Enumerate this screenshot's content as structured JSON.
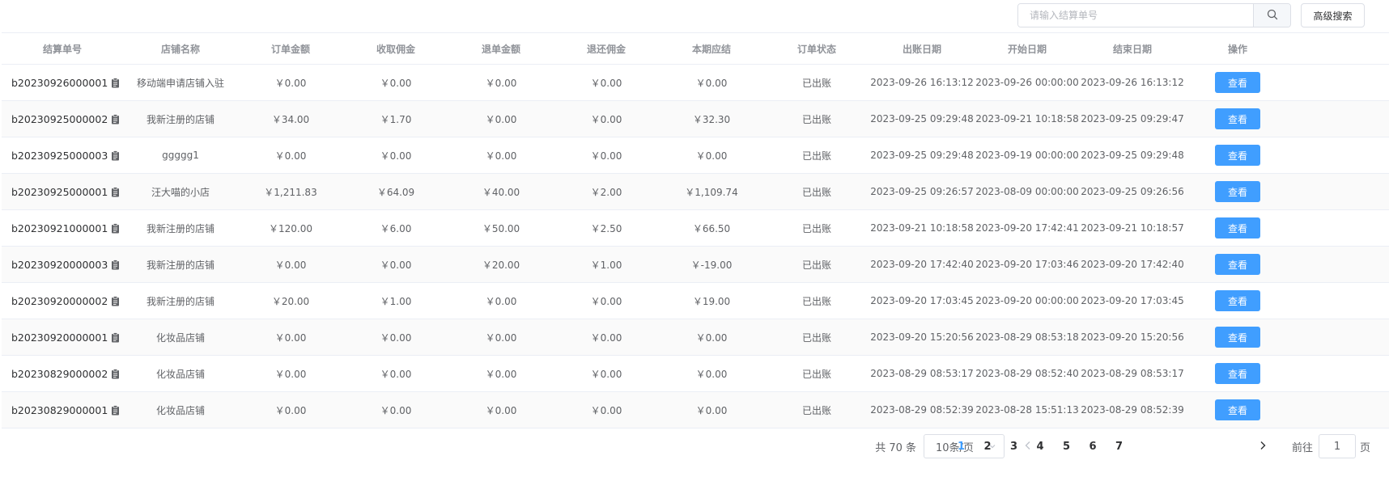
{
  "search": {
    "placeholder": "请输入结算单号",
    "icon": "search-icon"
  },
  "advanced_search_label": "高级搜索",
  "table": {
    "headers": [
      "结算单号",
      "店铺名称",
      "订单金额",
      "收取佣金",
      "退单金额",
      "退还佣金",
      "本期应结",
      "订单状态",
      "出账日期",
      "开始日期",
      "结束日期",
      "操作"
    ],
    "view_label": "查看",
    "rows": [
      {
        "sn": "b20230926000001",
        "store": "移动端申请店铺入驻",
        "order_amount": "￥0.00",
        "commission": "￥0.00",
        "refund_amount": "￥0.00",
        "refund_commission": "￥0.00",
        "payable": "￥0.00",
        "status": "已出账",
        "bill_date": "2023-09-26 16:13:12",
        "start_date": "2023-09-26 00:00:00",
        "end_date": "2023-09-26 16:13:12"
      },
      {
        "sn": "b20230925000002",
        "store": "我新注册的店铺",
        "order_amount": "￥34.00",
        "commission": "￥1.70",
        "refund_amount": "￥0.00",
        "refund_commission": "￥0.00",
        "payable": "￥32.30",
        "status": "已出账",
        "bill_date": "2023-09-25 09:29:48",
        "start_date": "2023-09-21 10:18:58",
        "end_date": "2023-09-25 09:29:47"
      },
      {
        "sn": "b20230925000003",
        "store": "ggggg1",
        "order_amount": "￥0.00",
        "commission": "￥0.00",
        "refund_amount": "￥0.00",
        "refund_commission": "￥0.00",
        "payable": "￥0.00",
        "status": "已出账",
        "bill_date": "2023-09-25 09:29:48",
        "start_date": "2023-09-19 00:00:00",
        "end_date": "2023-09-25 09:29:48"
      },
      {
        "sn": "b20230925000001",
        "store": "汪大喵的小店",
        "order_amount": "￥1,211.83",
        "commission": "￥64.09",
        "refund_amount": "￥40.00",
        "refund_commission": "￥2.00",
        "payable": "￥1,109.74",
        "status": "已出账",
        "bill_date": "2023-09-25 09:26:57",
        "start_date": "2023-08-09 00:00:00",
        "end_date": "2023-09-25 09:26:56"
      },
      {
        "sn": "b20230921000001",
        "store": "我新注册的店铺",
        "order_amount": "￥120.00",
        "commission": "￥6.00",
        "refund_amount": "￥50.00",
        "refund_commission": "￥2.50",
        "payable": "￥66.50",
        "status": "已出账",
        "bill_date": "2023-09-21 10:18:58",
        "start_date": "2023-09-20 17:42:41",
        "end_date": "2023-09-21 10:18:57"
      },
      {
        "sn": "b20230920000003",
        "store": "我新注册的店铺",
        "order_amount": "￥0.00",
        "commission": "￥0.00",
        "refund_amount": "￥20.00",
        "refund_commission": "￥1.00",
        "payable": "￥-19.00",
        "status": "已出账",
        "bill_date": "2023-09-20 17:42:40",
        "start_date": "2023-09-20 17:03:46",
        "end_date": "2023-09-20 17:42:40"
      },
      {
        "sn": "b20230920000002",
        "store": "我新注册的店铺",
        "order_amount": "￥20.00",
        "commission": "￥1.00",
        "refund_amount": "￥0.00",
        "refund_commission": "￥0.00",
        "payable": "￥19.00",
        "status": "已出账",
        "bill_date": "2023-09-20 17:03:45",
        "start_date": "2023-09-20 00:00:00",
        "end_date": "2023-09-20 17:03:45"
      },
      {
        "sn": "b20230920000001",
        "store": "化妆品店铺",
        "order_amount": "￥0.00",
        "commission": "￥0.00",
        "refund_amount": "￥0.00",
        "refund_commission": "￥0.00",
        "payable": "￥0.00",
        "status": "已出账",
        "bill_date": "2023-09-20 15:20:56",
        "start_date": "2023-08-29 08:53:18",
        "end_date": "2023-09-20 15:20:56"
      },
      {
        "sn": "b20230829000002",
        "store": "化妆品店铺",
        "order_amount": "￥0.00",
        "commission": "￥0.00",
        "refund_amount": "￥0.00",
        "refund_commission": "￥0.00",
        "payable": "￥0.00",
        "status": "已出账",
        "bill_date": "2023-08-29 08:53:17",
        "start_date": "2023-08-29 08:52:40",
        "end_date": "2023-08-29 08:53:17"
      },
      {
        "sn": "b20230829000001",
        "store": "化妆品店铺",
        "order_amount": "￥0.00",
        "commission": "￥0.00",
        "refund_amount": "￥0.00",
        "refund_commission": "￥0.00",
        "payable": "￥0.00",
        "status": "已出账",
        "bill_date": "2023-08-29 08:52:39",
        "start_date": "2023-08-28 15:51:13",
        "end_date": "2023-08-29 08:52:39"
      }
    ]
  },
  "pagination": {
    "total_label": "共 70 条",
    "page_size": "10条/页",
    "pages": [
      "1",
      "2",
      "3",
      "4",
      "5",
      "6",
      "7"
    ],
    "current_page": "1",
    "goto_label": "前往",
    "goto_value": "1",
    "goto_suffix": "页"
  },
  "colors": {
    "primary": "#409eff",
    "header_text": "#909399",
    "border": "#ebeef5",
    "stripe": "#fafafa"
  }
}
